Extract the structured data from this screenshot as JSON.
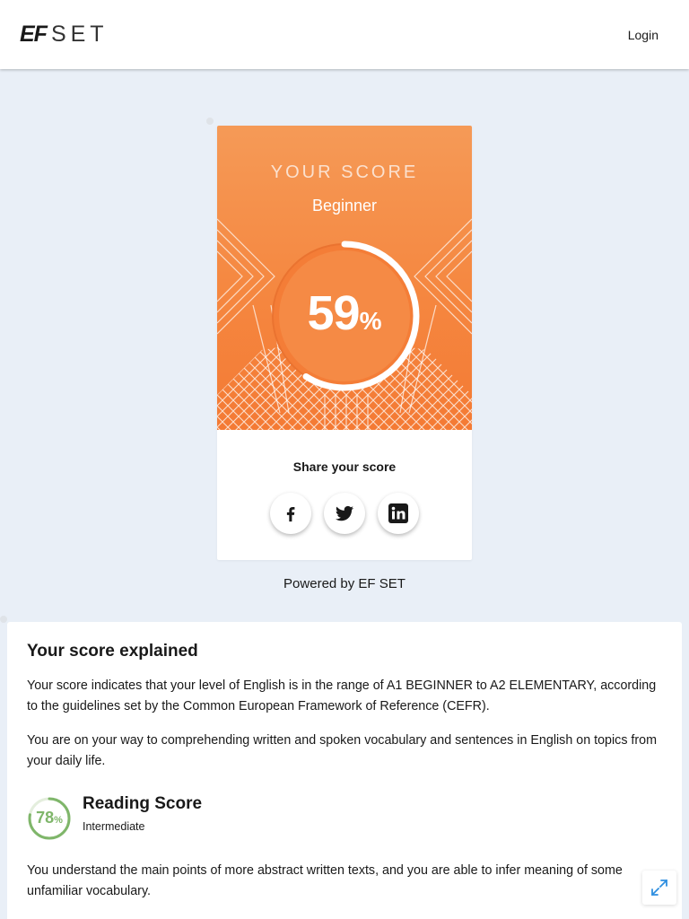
{
  "header": {
    "logo_ef": "EF",
    "logo_set": "SET",
    "login_label": "Login"
  },
  "score_card": {
    "title": "YOUR SCORE",
    "level": "Beginner",
    "score_value": "59",
    "score_unit": "%",
    "progress": 0.59,
    "share_label": "Share your score",
    "share_buttons": [
      "facebook-icon",
      "twitter-icon",
      "linkedin-icon"
    ]
  },
  "powered_by": "Powered by EF SET",
  "explanation": {
    "title": "Your score explained",
    "paragraph_1": "Your score indicates that your level of English is in the range of A1 BEGINNER to A2 ELEMENTARY, according to the guidelines set by the Common European Framework of Reference (CEFR).",
    "paragraph_2": "You are on your way to comprehending written and spoken vocabulary and sentences in English on topics from your daily life.",
    "reading": {
      "title": "Reading Score",
      "level": "Intermediate",
      "score_value": "78",
      "score_unit": "%",
      "progress": 0.78,
      "description": "You understand the main points of more abstract written texts, and you are able to infer meaning of some unfamiliar vocabulary."
    }
  },
  "colors": {
    "accent_orange": "#f58740",
    "reading_green": "#7fb66a",
    "page_bg": "#e9eff7"
  }
}
